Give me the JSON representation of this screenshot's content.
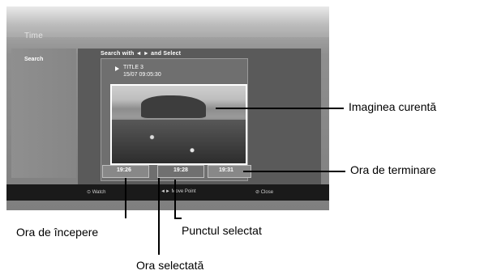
{
  "menu": {
    "title": "Time",
    "sidebar_item": "Search",
    "hint": "Search with ◄ ► and Select",
    "info": {
      "title_line": "TITLE 3",
      "date_time": "15/07   09:05:30"
    },
    "times": {
      "start": "19:26",
      "selected": "19:28",
      "end": "19:31"
    },
    "bottom": {
      "watch": "⊙ Watch",
      "move_point": "◄► Move Point",
      "close": "⊘ Close"
    }
  },
  "callouts": {
    "current_image": "Imaginea curentă",
    "end_time": "Ora de terminare",
    "start_time": "Ora de începere",
    "selected_point": "Punctul selectat",
    "selected_time": "Ora selectată"
  },
  "colors": {
    "background": "#ffffff",
    "screen_dark": "#1a1a1a",
    "panel": "#5a5a5a"
  }
}
